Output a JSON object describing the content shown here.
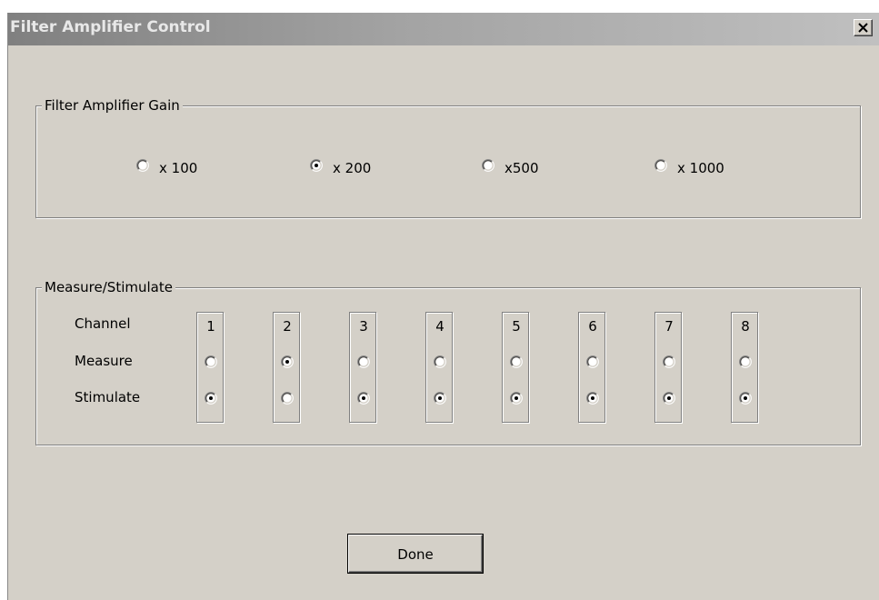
{
  "window": {
    "title": "Filter Amplifier Control",
    "close_icon": "close-icon"
  },
  "gain_group": {
    "legend": "Filter Amplifier Gain",
    "options": [
      {
        "label": "x 100",
        "selected": false
      },
      {
        "label": "x 200",
        "selected": true
      },
      {
        "label": "x500",
        "selected": false
      },
      {
        "label": "x 1000",
        "selected": false
      }
    ]
  },
  "measure_group": {
    "legend": "Measure/Stimulate",
    "row_labels": {
      "channel": "Channel",
      "measure": "Measure",
      "stimulate": "Stimulate"
    },
    "channels": [
      {
        "number": "1",
        "mode": "stimulate"
      },
      {
        "number": "2",
        "mode": "measure"
      },
      {
        "number": "3",
        "mode": "stimulate"
      },
      {
        "number": "4",
        "mode": "stimulate"
      },
      {
        "number": "5",
        "mode": "stimulate"
      },
      {
        "number": "6",
        "mode": "stimulate"
      },
      {
        "number": "7",
        "mode": "stimulate"
      },
      {
        "number": "8",
        "mode": "stimulate"
      }
    ]
  },
  "done_button": {
    "label": "Done"
  },
  "colors": {
    "dialog_bg": "#d4d0c8",
    "titlebar_inactive": "#a3a3a3"
  }
}
